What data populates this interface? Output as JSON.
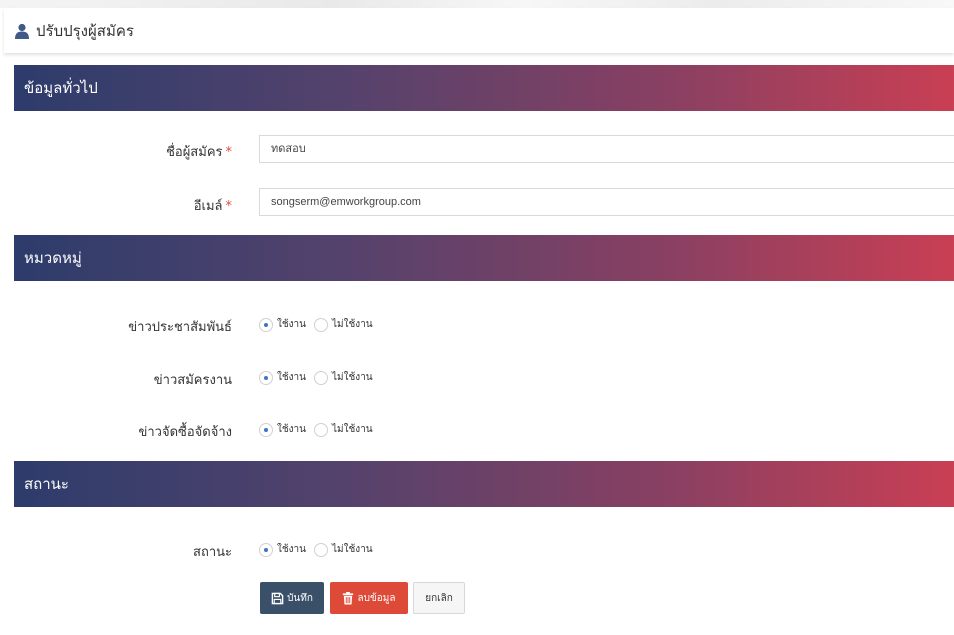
{
  "page": {
    "title": "ปรับปรุงผู้สมัคร"
  },
  "sections": {
    "general": "ข้อมูลทั่วไป",
    "category": "หมวดหมู่",
    "status": "สถานะ"
  },
  "fields": {
    "name": {
      "label": "ชื่อผู้สมัคร",
      "required_mark": "*",
      "value": "ทดสอบ"
    },
    "email": {
      "label": "อีเมล์",
      "required_mark": "*",
      "value": "songserm@emworkgroup.com"
    }
  },
  "radio_options": {
    "on": "ใช้งาน",
    "off": "ไม่ใช้งาน"
  },
  "categories": [
    {
      "label": "ข่าวประชาสัมพันธ์",
      "selected": "on"
    },
    {
      "label": "ข่าวสมัครงาน",
      "selected": "on"
    },
    {
      "label": "ข่าวจัดซื้อจัดจ้าง",
      "selected": "on"
    }
  ],
  "status": {
    "label": "สถานะ",
    "selected": "on"
  },
  "buttons": {
    "save": "บันทึก",
    "delete": "ลบข้อมูล",
    "cancel": "ยกเลิก"
  },
  "icons": {
    "title": "user-icon",
    "save": "floppy-disk-icon",
    "delete": "trash-icon"
  },
  "colors": {
    "save": "#3a5068",
    "delete": "#de4a38",
    "header_start": "#2d3c6b",
    "header_end": "#c93f54",
    "radio_active": "#3c74c7",
    "required": "#e04a3f"
  }
}
